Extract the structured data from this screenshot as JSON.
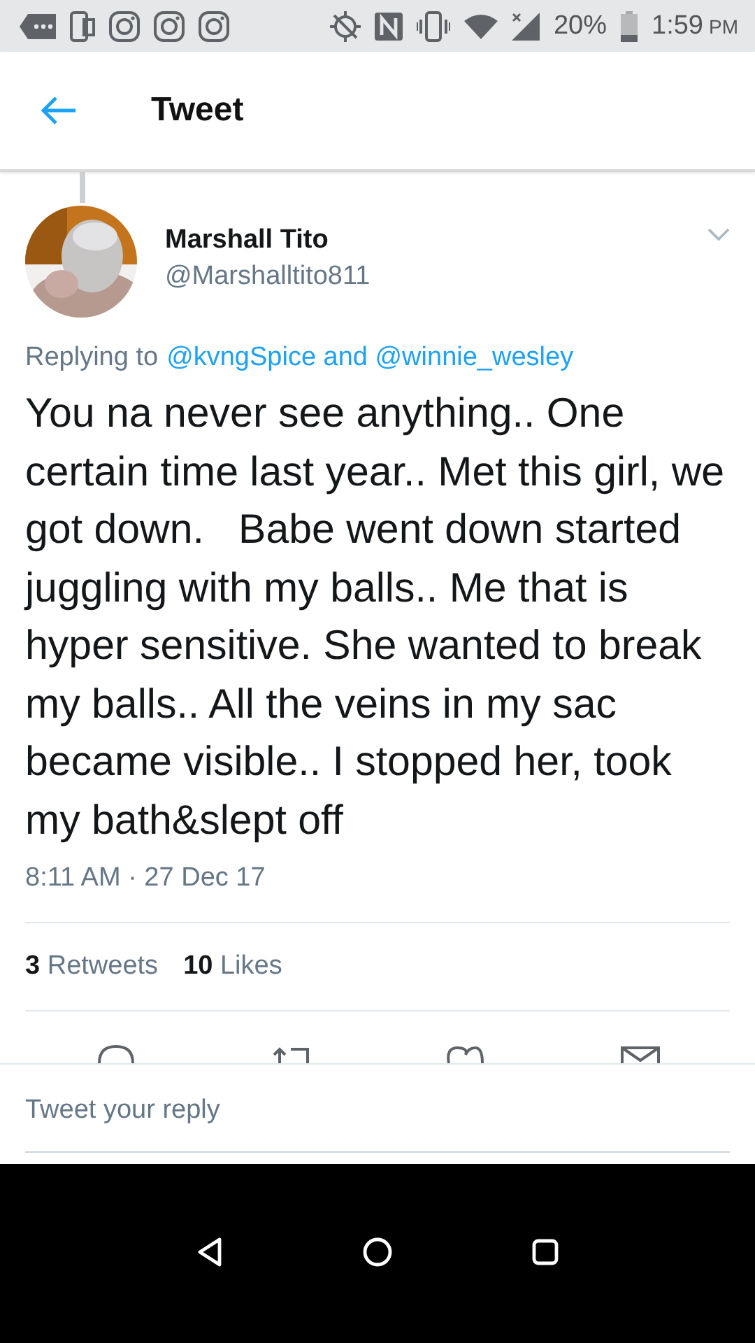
{
  "status_bar": {
    "battery": "20%",
    "time": "1:59",
    "ampm": "PM"
  },
  "app_bar": {
    "title": "Tweet"
  },
  "tweet": {
    "name": "Marshall Tito",
    "handle": "@Marshalltito811",
    "replying": {
      "prefix": "Replying to",
      "mentions": "@kvngSpice and @winnie_wesley"
    },
    "text": "You na never see anything.. One certain time last year.. Met this girl, we got down.   Babe went down started juggling with my balls.. Me that is hyper sensitive. She wanted to break my balls.. All the veins in my sac became visible.. I stopped her, took my bath&slept off",
    "timestamp": "8:11 AM · 27 Dec 17",
    "stats": [
      {
        "count": "3",
        "label": "Retweets"
      },
      {
        "count": "10",
        "label": "Likes"
      }
    ]
  },
  "reply_field": {
    "placeholder": "Tweet your reply"
  }
}
